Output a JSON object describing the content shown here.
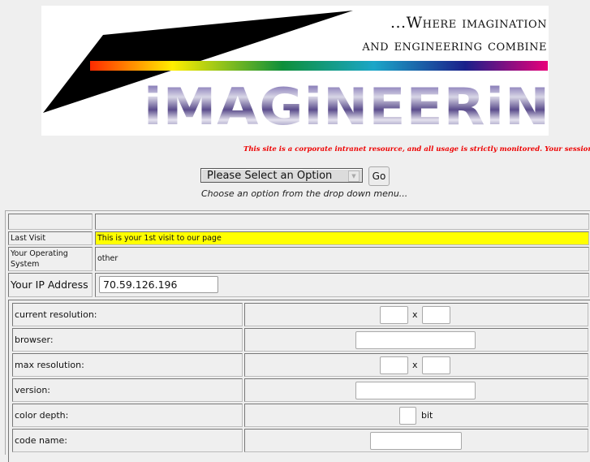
{
  "logo": {
    "tagline_line1": "...Where imagination",
    "tagline_line2": "and engineering combine",
    "wordmark": "iMAGiNEERiNG",
    "spectrum_colors": [
      "#ff2a00",
      "#ffee00",
      "#0e8f3a",
      "#1aa6c8",
      "#1a1f8a",
      "#e8007a"
    ]
  },
  "notice": {
    "text": "This site is a corporate intranet resource, and all usage is strictly monitored.  Your session inform",
    "color": "#ee0000"
  },
  "nav": {
    "select_value": "Please Select an Option",
    "go_label": "Go",
    "hint": "Choose an option from the drop down menu..."
  },
  "info": {
    "header_left": "",
    "header_right": "",
    "rows": [
      {
        "label": "Last Visit",
        "value": "This is your 1st visit to our page"
      },
      {
        "label": "Your Operating System",
        "value": "other"
      },
      {
        "label": "Your IP Address",
        "value": "70.59.126.196"
      }
    ]
  },
  "client": {
    "rows": [
      {
        "label": "current resolution:",
        "type": "pair",
        "sep": "x",
        "values": [
          "",
          ""
        ]
      },
      {
        "label": "browser:",
        "type": "wide",
        "values": [
          ""
        ]
      },
      {
        "label": "max resolution:",
        "type": "pair",
        "sep": "x",
        "values": [
          "",
          ""
        ]
      },
      {
        "label": "version:",
        "type": "wide",
        "values": [
          ""
        ]
      },
      {
        "label": "color depth:",
        "type": "small",
        "suffix": "bit",
        "values": [
          ""
        ]
      },
      {
        "label": "code name:",
        "type": "medium",
        "values": [
          ""
        ]
      }
    ]
  },
  "colors": {
    "page_bg": "#efefef",
    "highlight": "#ffff00"
  }
}
